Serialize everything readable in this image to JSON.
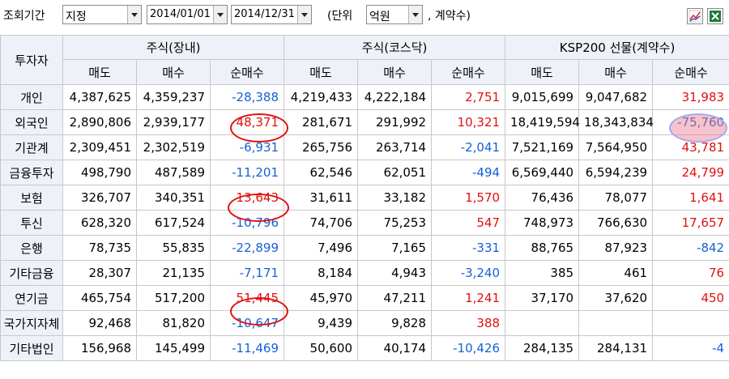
{
  "toolbar": {
    "period_label": "조회기간",
    "period_mode": "지정",
    "start_date": "2014/01/01",
    "end_date": "2014/12/31",
    "unit_prefix": "(단위",
    "unit_value": "억원",
    "unit_suffix": ", 계약수)"
  },
  "table": {
    "investor_header": "투자자",
    "groups": [
      "주식(장내)",
      "주식(코스닥)",
      "KSP200 선물(계약수)"
    ],
    "sub_headers": [
      "매도",
      "매수",
      "순매수",
      "매도",
      "매수",
      "순매수",
      "매도",
      "매수",
      "순매수"
    ],
    "rows": [
      {
        "name": "개인",
        "cells": [
          "4,387,625",
          "4,359,237",
          "-28,388",
          "4,219,433",
          "4,222,184",
          "2,751",
          "9,015,699",
          "9,047,682",
          "31,983"
        ]
      },
      {
        "name": "외국인",
        "cells": [
          "2,890,806",
          "2,939,177",
          "48,371",
          "281,671",
          "291,992",
          "10,321",
          "18,419,594",
          "18,343,834",
          "-75,760"
        ]
      },
      {
        "name": "기관계",
        "cells": [
          "2,309,451",
          "2,302,519",
          "-6,931",
          "265,756",
          "263,714",
          "-2,041",
          "7,521,169",
          "7,564,950",
          "43,781"
        ]
      },
      {
        "name": "금융투자",
        "cells": [
          "498,790",
          "487,589",
          "-11,201",
          "62,546",
          "62,051",
          "-494",
          "6,569,440",
          "6,594,239",
          "24,799"
        ]
      },
      {
        "name": "보험",
        "cells": [
          "326,707",
          "340,351",
          "13,643",
          "31,611",
          "33,182",
          "1,570",
          "76,436",
          "78,077",
          "1,641"
        ]
      },
      {
        "name": "투신",
        "cells": [
          "628,320",
          "617,524",
          "-10,796",
          "74,706",
          "75,253",
          "547",
          "748,973",
          "766,630",
          "17,657"
        ]
      },
      {
        "name": "은행",
        "cells": [
          "78,735",
          "55,835",
          "-22,899",
          "7,496",
          "7,165",
          "-331",
          "88,765",
          "87,923",
          "-842"
        ]
      },
      {
        "name": "기타금융",
        "cells": [
          "28,307",
          "21,135",
          "-7,171",
          "8,184",
          "4,943",
          "-3,240",
          "385",
          "461",
          "76"
        ]
      },
      {
        "name": "연기금",
        "cells": [
          "465,754",
          "517,200",
          "51,445",
          "45,970",
          "47,211",
          "1,241",
          "37,170",
          "37,620",
          "450"
        ]
      },
      {
        "name": "국가지자체",
        "cells": [
          "92,468",
          "81,820",
          "-10,647",
          "9,439",
          "9,828",
          "388",
          "",
          "",
          ""
        ]
      },
      {
        "name": "기타법인",
        "cells": [
          "156,968",
          "145,499",
          "-11,469",
          "50,600",
          "40,174",
          "-10,426",
          "284,135",
          "284,131",
          "-4"
        ]
      }
    ]
  },
  "colors": {
    "negative": "#1560d6",
    "positive": "#e01010",
    "header_bg": "#eef2f8"
  }
}
